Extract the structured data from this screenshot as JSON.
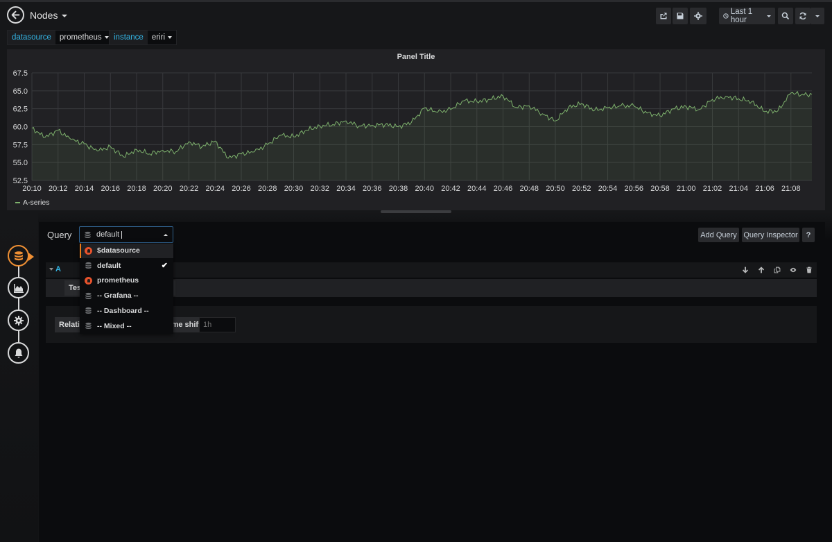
{
  "header": {
    "title": "Nodes",
    "time_range_label": "Last 1 hour",
    "icons": [
      "share-icon",
      "save-icon",
      "settings-icon",
      "clock-icon",
      "zoom-out-icon",
      "refresh-icon",
      "refresh-interval-caret"
    ]
  },
  "variables": [
    {
      "label": "datasource",
      "value": "prometheus"
    },
    {
      "label": "instance",
      "value": "eriri"
    }
  ],
  "panel": {
    "title": "Panel Title",
    "legend": [
      "A-series"
    ]
  },
  "chart_data": {
    "type": "area",
    "title": "Panel Title",
    "xlabel": "",
    "ylabel": "",
    "ylim": [
      52.5,
      67.5
    ],
    "yticks": [
      "52.5",
      "55.0",
      "57.5",
      "60.0",
      "62.5",
      "65.0",
      "67.5"
    ],
    "xticks": [
      "20:10",
      "20:12",
      "20:14",
      "20:16",
      "20:18",
      "20:20",
      "20:22",
      "20:24",
      "20:26",
      "20:28",
      "20:30",
      "20:32",
      "20:34",
      "20:36",
      "20:38",
      "20:40",
      "20:42",
      "20:44",
      "20:46",
      "20:48",
      "20:50",
      "20:52",
      "20:54",
      "20:56",
      "20:58",
      "21:00",
      "21:02",
      "21:04",
      "21:06",
      "21:08"
    ],
    "x_range_minutes": [
      0,
      59.6
    ],
    "x_start": "20:10",
    "grid": true,
    "legend_position": "bottom-left",
    "series": [
      {
        "name": "A-series",
        "color": "#7eb26d",
        "x_minutes": [
          0,
          1,
          2,
          3,
          4,
          5,
          6,
          7,
          8,
          9,
          10,
          11,
          12,
          13,
          14,
          15,
          16,
          17,
          18,
          19,
          20,
          21,
          22,
          23,
          24,
          25,
          26,
          27,
          28,
          29,
          30,
          31,
          32,
          33,
          34,
          35,
          36,
          37,
          38,
          39,
          40,
          41,
          42,
          43,
          44,
          45,
          46,
          47,
          48,
          49,
          50,
          51,
          52,
          53,
          54,
          55,
          56,
          57,
          58,
          59,
          59.6
        ],
        "values": [
          59.8,
          58.5,
          59.5,
          58.2,
          57.6,
          56.6,
          57.2,
          55.8,
          56.8,
          56.2,
          56.7,
          56.5,
          57.9,
          57.2,
          58.0,
          55.6,
          56.2,
          56.5,
          57.5,
          58.8,
          58.6,
          59.5,
          60.1,
          60.3,
          60.8,
          60.1,
          60.2,
          60.3,
          60.0,
          60.6,
          62.6,
          62.0,
          62.4,
          63.6,
          63.5,
          63.8,
          64.3,
          62.7,
          62.9,
          61.8,
          60.8,
          62.7,
          63.2,
          62.3,
          62.6,
          62.9,
          62.9,
          61.9,
          61.5,
          62.5,
          62.8,
          62.4,
          63.8,
          64.2,
          63.9,
          63.5,
          62.1,
          62.2,
          64.7,
          64.4,
          64.5
        ]
      }
    ]
  },
  "editor": {
    "query_label": "Query",
    "datasource_input_value": "default",
    "buttons": {
      "add_query": "Add Query",
      "query_inspector": "Query Inspector",
      "help": "?"
    },
    "query_letter": "A",
    "test_field_label": "Test",
    "relative_time_label": "Relative time",
    "time_shift_label": "Time shift",
    "time_shift_placeholder": "1h",
    "datasource_options": [
      {
        "name": "$datasource",
        "icon": "prometheus-icon",
        "focused": true,
        "selected": false
      },
      {
        "name": "default",
        "icon": "database-icon",
        "focused": false,
        "selected": true
      },
      {
        "name": "prometheus",
        "icon": "prometheus-icon",
        "focused": false,
        "selected": false
      },
      {
        "name": "-- Grafana --",
        "icon": "database-icon",
        "focused": false,
        "selected": false
      },
      {
        "name": "-- Dashboard --",
        "icon": "database-icon",
        "focused": false,
        "selected": false
      },
      {
        "name": "-- Mixed --",
        "icon": "database-icon",
        "focused": false,
        "selected": false
      }
    ],
    "steps": [
      "queries",
      "visualization",
      "general",
      "alert"
    ]
  },
  "colors": {
    "accent_orange": "#f09034",
    "variable_label": "#33b5e5",
    "series": "#7eb26d",
    "background": "#161719",
    "panel": "#212124"
  }
}
